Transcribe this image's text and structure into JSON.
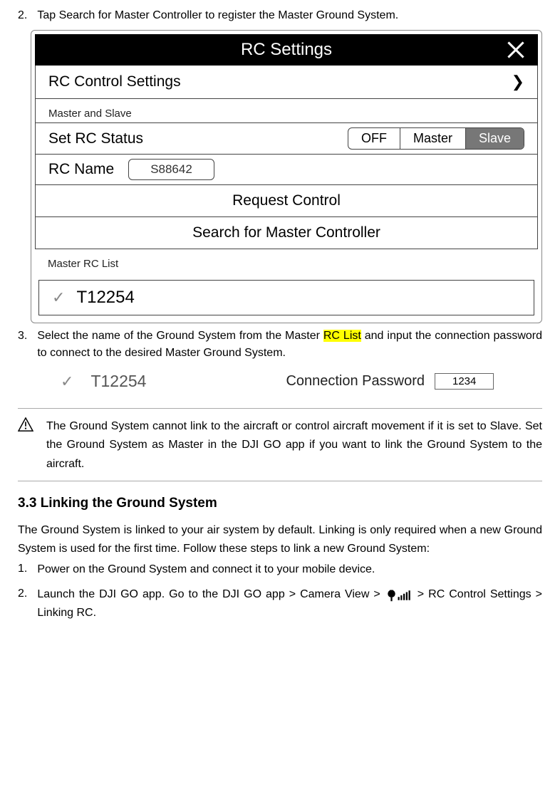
{
  "step2": {
    "num": "2.",
    "text": "Tap Search for Master Controller to register the Master Ground System."
  },
  "device": {
    "title": "RC Settings",
    "rc_control_settings": "RC Control Settings",
    "master_slave_label": "Master and Slave",
    "set_status_label": "Set RC Status",
    "segments": {
      "off": "OFF",
      "master": "Master",
      "slave": "Slave"
    },
    "rc_name_label": "RC Name",
    "rc_name_value": "S88642",
    "request_control": "Request Control",
    "search_master": "Search for Master Controller",
    "master_list_label": "Master RC List",
    "master_item": "T12254"
  },
  "step3": {
    "num": "3.",
    "prefix": "Select the name of the Ground System from the Master ",
    "highlight": "RC List",
    "suffix": " and input the connection password to connect to the desired Master Ground System."
  },
  "conn": {
    "name": "T12254",
    "label": "Connection Password",
    "value": "1234"
  },
  "warning": "The Ground System cannot link to the aircraft or control aircraft movement if it is set to Slave. Set the Ground System as Master in the DJI GO app if you want to link the Ground System to the aircraft.",
  "section_heading": "3.3 Linking the Ground System",
  "intro": "The Ground System is linked to your air system by default. Linking is only required when a new Ground System is used for the first time. Follow these steps to link a new Ground System:",
  "link_step1": {
    "num": "1.",
    "text": "Power on the Ground System and connect it to your mobile device."
  },
  "link_step2": {
    "num": "2.",
    "part1": "Launch the DJI GO app. Go to the DJI GO app > Camera View >",
    "part2": " > RC Control Settings > Linking RC."
  }
}
